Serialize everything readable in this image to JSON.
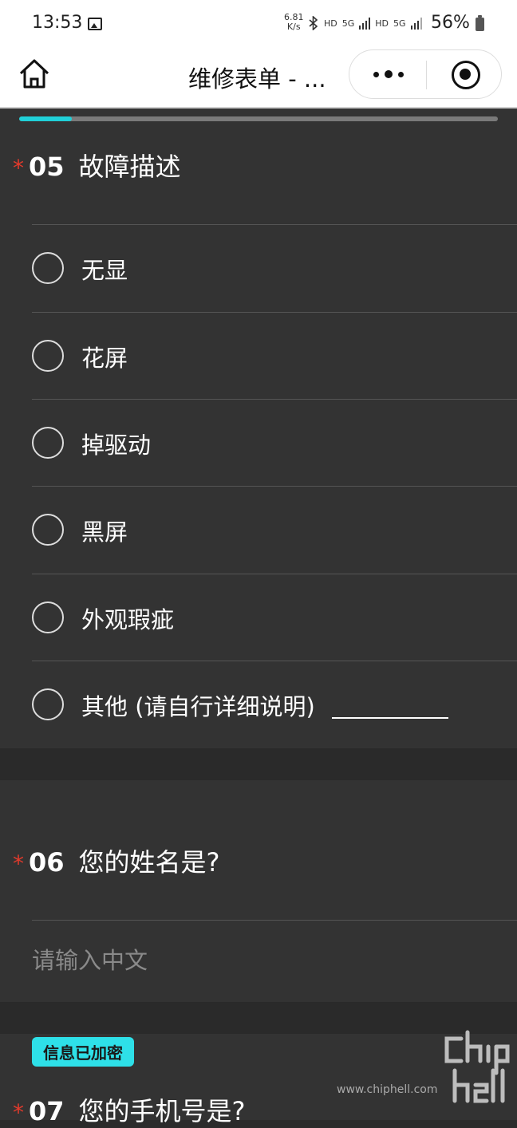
{
  "status": {
    "time": "13:53",
    "speed_value": "6.81",
    "speed_unit": "K/s",
    "icons": [
      "image-icon",
      "bluetooth-icon",
      "hd-icon",
      "5g-signal-icon",
      "hd-icon",
      "5g-signal-icon"
    ],
    "hd": "HD",
    "net": "5G",
    "battery": "56%"
  },
  "navbar": {
    "title": "维修表单 - ..."
  },
  "progress": {
    "fraction": 0.11,
    "color": "#20d0d8"
  },
  "q05": {
    "star": "*",
    "number": "05",
    "title": "故障描述",
    "options": [
      {
        "label": "无显"
      },
      {
        "label": "花屏"
      },
      {
        "label": "掉驱动"
      },
      {
        "label": "黑屏"
      },
      {
        "label": "外观瑕疵"
      },
      {
        "label": "其他 (请自行详细说明)"
      }
    ]
  },
  "q06": {
    "star": "*",
    "number": "06",
    "title": "您的姓名是?",
    "placeholder": "请输入中文"
  },
  "q07": {
    "badge": "信息已加密",
    "star": "*",
    "number": "07",
    "title": "您的手机号是?"
  },
  "watermark": {
    "text": "www.chiphell.com"
  },
  "colors": {
    "accent": "#20d0d8",
    "required": "#e23a2c",
    "background": "#333333"
  }
}
